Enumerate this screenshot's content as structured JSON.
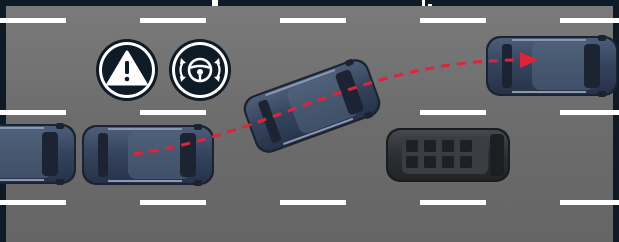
{
  "scene": {
    "frame_color": "#0e1a26",
    "road_color": "#6f6f6f",
    "lane_marking_color": "#ffffff",
    "path_color": "#e0223a"
  },
  "icons": [
    {
      "name": "warning-icon"
    },
    {
      "name": "steering-assist-icon"
    }
  ],
  "vehicles": [
    {
      "name": "car-left-edge",
      "color": "#3a4a63"
    },
    {
      "name": "car-ego",
      "color": "#3a4a63"
    },
    {
      "name": "car-changing-lane",
      "color": "#3a4a63"
    },
    {
      "name": "car-target-position",
      "color": "#3a4a63"
    },
    {
      "name": "van-dark",
      "color": "#2e3136"
    }
  ]
}
